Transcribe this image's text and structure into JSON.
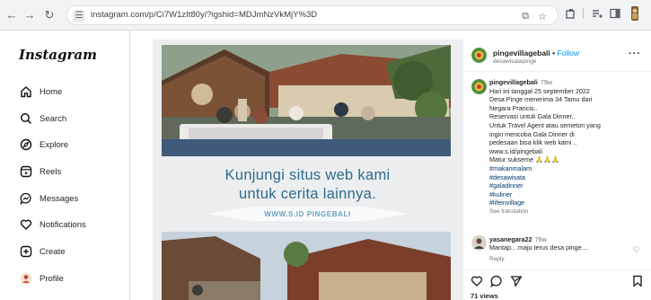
{
  "browser": {
    "back_icon": "back-arrow-icon",
    "forward_icon": "forward-arrow-icon",
    "reload_icon": "reload-icon",
    "url": "instagram.com/p/Ci7W1zIt80y/?igshid=MDJmNzVkMjY%3D"
  },
  "sidebar": {
    "logo": "Instagram",
    "items": [
      {
        "label": "Home",
        "icon": "home-icon"
      },
      {
        "label": "Search",
        "icon": "search-icon"
      },
      {
        "label": "Explore",
        "icon": "explore-icon"
      },
      {
        "label": "Reels",
        "icon": "reels-icon"
      },
      {
        "label": "Messages",
        "icon": "messages-icon"
      },
      {
        "label": "Notifications",
        "icon": "heart-icon"
      },
      {
        "label": "Create",
        "icon": "create-icon"
      },
      {
        "label": "Profile",
        "icon": "profile-avatar-icon"
      }
    ]
  },
  "post": {
    "promo_line1": "Kunjungi situs web kami",
    "promo_line2": "untuk cerita lainnya.",
    "promo_url": "WWW.S.ID PINGEBALI"
  },
  "panel": {
    "header": {
      "username": "pingevillagebali",
      "separator": " • ",
      "follow": "Follow",
      "subtitle": "desawisatapinge"
    },
    "caption": {
      "username": "pingevillagebali",
      "time": "79w",
      "lines": [
        "Hari ini tanggal 25 september 2022",
        "Desa Pinge menerima 34 Tamu dari",
        "Negara Prancis..",
        "Reservasi untuk Gala Dinner..",
        "Untuk Travel Agent atau semeton yang",
        "ingin mencoba Gala Dinner di",
        "pedesaan bisa klik web kami ..",
        "www.s.id/pingebali",
        "Matur sukseme 🙏🙏🙏"
      ],
      "hashtags": [
        "#makanmalam",
        "#desawisata",
        "#galadinner",
        "#kuliner",
        "#lifeinvillage"
      ],
      "see_translation": "See translation"
    },
    "comment": {
      "username": "yasanegara22",
      "time": "76w",
      "text": "Mantap....maju terus desa pinge....",
      "reply": "Reply"
    },
    "views": "71 views"
  },
  "colors": {
    "link_blue": "#0095f6",
    "hashtag_blue": "#00376b",
    "promo_blue": "#2f6a8c"
  }
}
